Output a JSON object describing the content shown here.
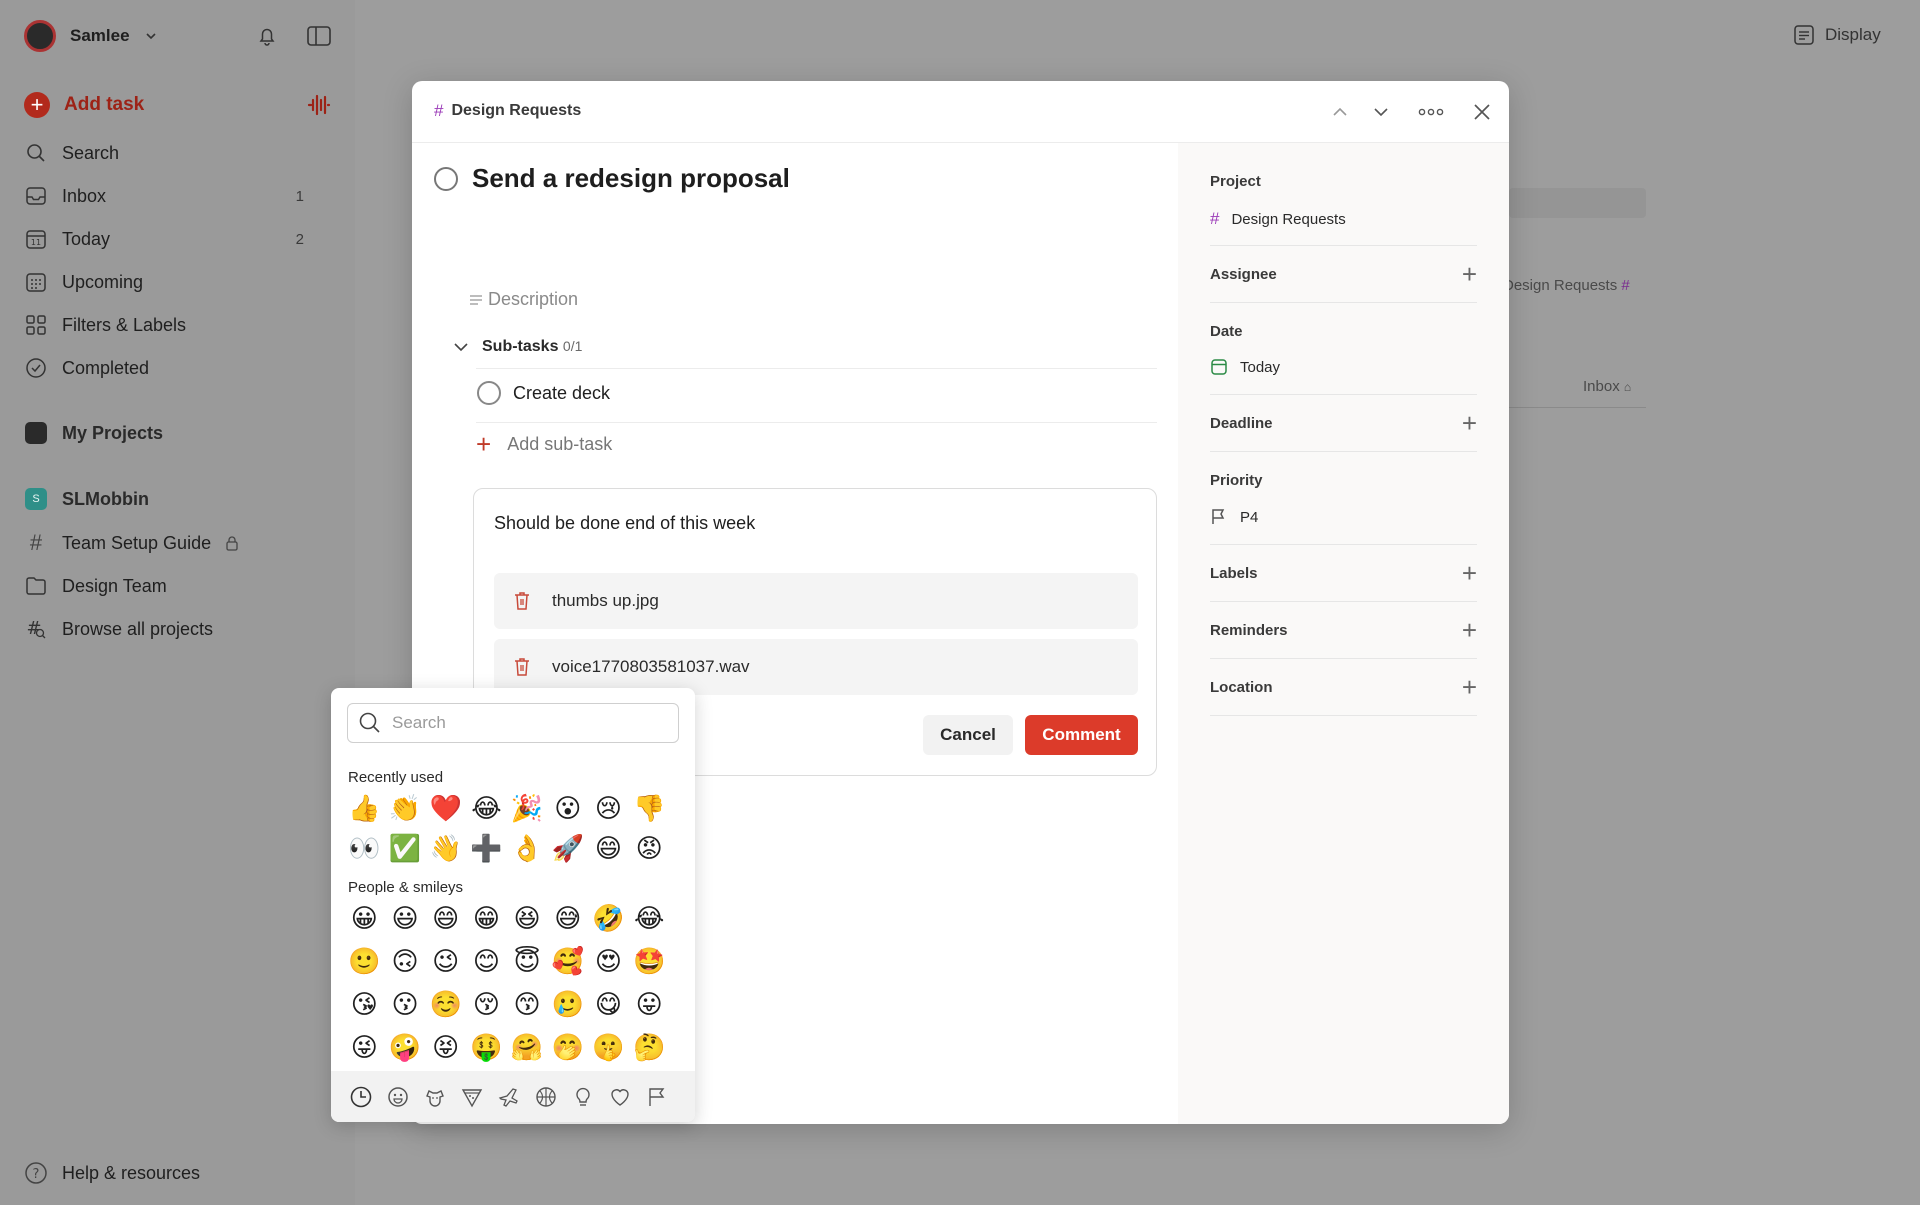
{
  "sidebar": {
    "user": "Samlee",
    "add_task": "Add task",
    "items": [
      {
        "label": "Search",
        "count": ""
      },
      {
        "label": "Inbox",
        "count": "1"
      },
      {
        "label": "Today",
        "count": "2"
      },
      {
        "label": "Upcoming",
        "count": ""
      },
      {
        "label": "Filters & Labels",
        "count": ""
      },
      {
        "label": "Completed",
        "count": ""
      }
    ],
    "my_projects": "My Projects",
    "workspace": {
      "name": "SLMobbin",
      "badge": "S"
    },
    "projects": [
      "Team Setup Guide",
      "Design Team",
      "Browse all projects"
    ],
    "help": "Help & resources"
  },
  "topbar": {
    "display": "Display"
  },
  "background": {
    "project_tag": "Design Requests",
    "inbox_tag": "Inbox"
  },
  "modal": {
    "breadcrumb": "Design Requests",
    "title": "Send a redesign proposal",
    "description_placeholder": "Description",
    "subtasks_label": "Sub-tasks",
    "subtasks_count": "0/1",
    "subtasks": [
      "Create deck"
    ],
    "add_subtask": "Add sub-task",
    "comment": {
      "text": "Should be done end of this week",
      "attachments": [
        "thumbs up.jpg",
        "voice1770803581037.wav"
      ],
      "cancel": "Cancel",
      "submit": "Comment"
    },
    "details": {
      "project_label": "Project",
      "project_value": "Design Requests",
      "assignee_label": "Assignee",
      "date_label": "Date",
      "date_value": "Today",
      "deadline_label": "Deadline",
      "priority_label": "Priority",
      "priority_value": "P4",
      "labels_label": "Labels",
      "reminders_label": "Reminders",
      "location_label": "Location"
    }
  },
  "emoji_picker": {
    "search_placeholder": "Search",
    "recent_label": "Recently used",
    "recent": [
      "👍",
      "👏",
      "❤️",
      "😂",
      "🎉",
      "😮",
      "😢",
      "👎",
      "👀",
      "✅",
      "👋",
      "➕",
      "👌",
      "🚀",
      "😄",
      "😡"
    ],
    "people_label": "People & smileys",
    "people": [
      "😀",
      "😃",
      "😄",
      "😁",
      "😆",
      "😅",
      "🤣",
      "😂",
      "🙂",
      "🙃",
      "😉",
      "😊",
      "😇",
      "🥰",
      "😍",
      "🤩",
      "😘",
      "😗",
      "☺️",
      "😚",
      "😙",
      "🥲",
      "😋",
      "😛",
      "😜",
      "🤪",
      "😝",
      "🤑",
      "🤗",
      "🤭",
      "🤫",
      "🤔"
    ],
    "categories": [
      "clock-icon",
      "smiley-icon",
      "animal-icon",
      "food-icon",
      "travel-icon",
      "activity-icon",
      "bulb-icon",
      "heart-icon",
      "flag-icon"
    ]
  },
  "colors": {
    "accent": "#dc3b2a",
    "project_hash": "#9b3bb8",
    "date_green": "#2a8a45"
  }
}
